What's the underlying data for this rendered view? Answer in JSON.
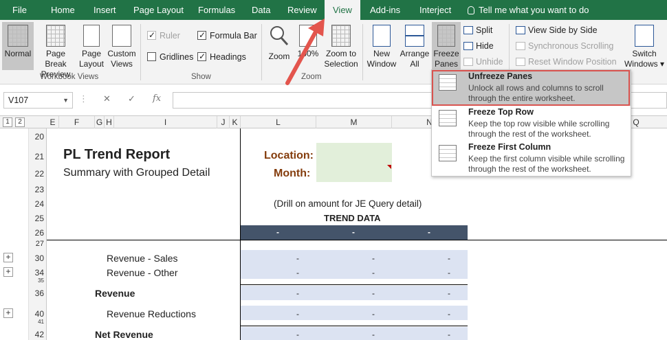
{
  "tabs": [
    {
      "label": "File"
    },
    {
      "label": "Home"
    },
    {
      "label": "Insert"
    },
    {
      "label": "Page Layout"
    },
    {
      "label": "Formulas"
    },
    {
      "label": "Data"
    },
    {
      "label": "Review"
    },
    {
      "label": "View"
    },
    {
      "label": "Add-ins"
    },
    {
      "label": "Interject"
    }
  ],
  "tell_me": "Tell me what you want to do",
  "ribbon": {
    "workbook_views": {
      "normal": "Normal",
      "page_break_1": "Page Break",
      "page_break_2": "Preview",
      "page_layout_1": "Page",
      "page_layout_2": "Layout",
      "custom_views_1": "Custom",
      "custom_views_2": "Views",
      "group_label": "Workbook Views"
    },
    "show": {
      "ruler": "Ruler",
      "formula_bar": "Formula Bar",
      "gridlines": "Gridlines",
      "headings": "Headings",
      "group_label": "Show"
    },
    "zoom": {
      "zoom": "Zoom",
      "zoom100": "100%",
      "zoom_sel_1": "Zoom to",
      "zoom_sel_2": "Selection",
      "group_label": "Zoom"
    },
    "window": {
      "new_window_1": "New",
      "new_window_2": "Window",
      "arrange_all_1": "Arrange",
      "arrange_all_2": "All",
      "freeze_1": "Freeze",
      "freeze_2": "Panes ▾",
      "split": "Split",
      "hide": "Hide",
      "unhide": "Unhide",
      "side_by_side": "View Side by Side",
      "sync_scroll": "Synchronous Scrolling",
      "reset_pos": "Reset Window Position",
      "switch_1": "Switch",
      "switch_2": "Windows ▾"
    }
  },
  "formula_bar": {
    "name_box": "V107",
    "cancel": "✕",
    "enter": "✓",
    "fx": "fx"
  },
  "outline_levels": [
    "1",
    "2"
  ],
  "columns": [
    "E",
    "F",
    "G",
    "H",
    "I",
    "J",
    "K",
    "L",
    "M",
    "N",
    "Q"
  ],
  "rows": [
    "20",
    "21",
    "22",
    "23",
    "24",
    "25",
    "26",
    "27",
    "30",
    "34",
    "35",
    "36",
    "40",
    "41",
    "42"
  ],
  "report": {
    "title": "PL Trend Report",
    "subtitle": "Summary with Grouped Detail",
    "location_label": "Location:",
    "month_label": "Month:",
    "drill_note": "(Drill on amount for JE Query detail)",
    "trend_header": "TREND DATA",
    "dash": "-",
    "lines": {
      "rev_sales": "Revenue - Sales",
      "rev_other": "Revenue - Other",
      "revenue": "Revenue",
      "rev_reductions": "Revenue Reductions",
      "net_revenue": "Net Revenue"
    }
  },
  "freeze_menu": [
    {
      "title": "Unfreeze Panes",
      "desc": "Unlock all rows and columns to scroll through the entire worksheet."
    },
    {
      "title": "Freeze Top Row",
      "desc": "Keep the top row visible while scrolling through the rest of the worksheet."
    },
    {
      "title": "Freeze First Column",
      "desc": "Keep the first column visible while scrolling through the rest of the worksheet."
    }
  ],
  "colors": {
    "excel_green": "#217346",
    "band_blue": "#dce3f2",
    "header_dark": "#44546a",
    "label_brown": "#843c0c",
    "input_green": "#e2efda",
    "highlight_red": "#d9534f"
  }
}
